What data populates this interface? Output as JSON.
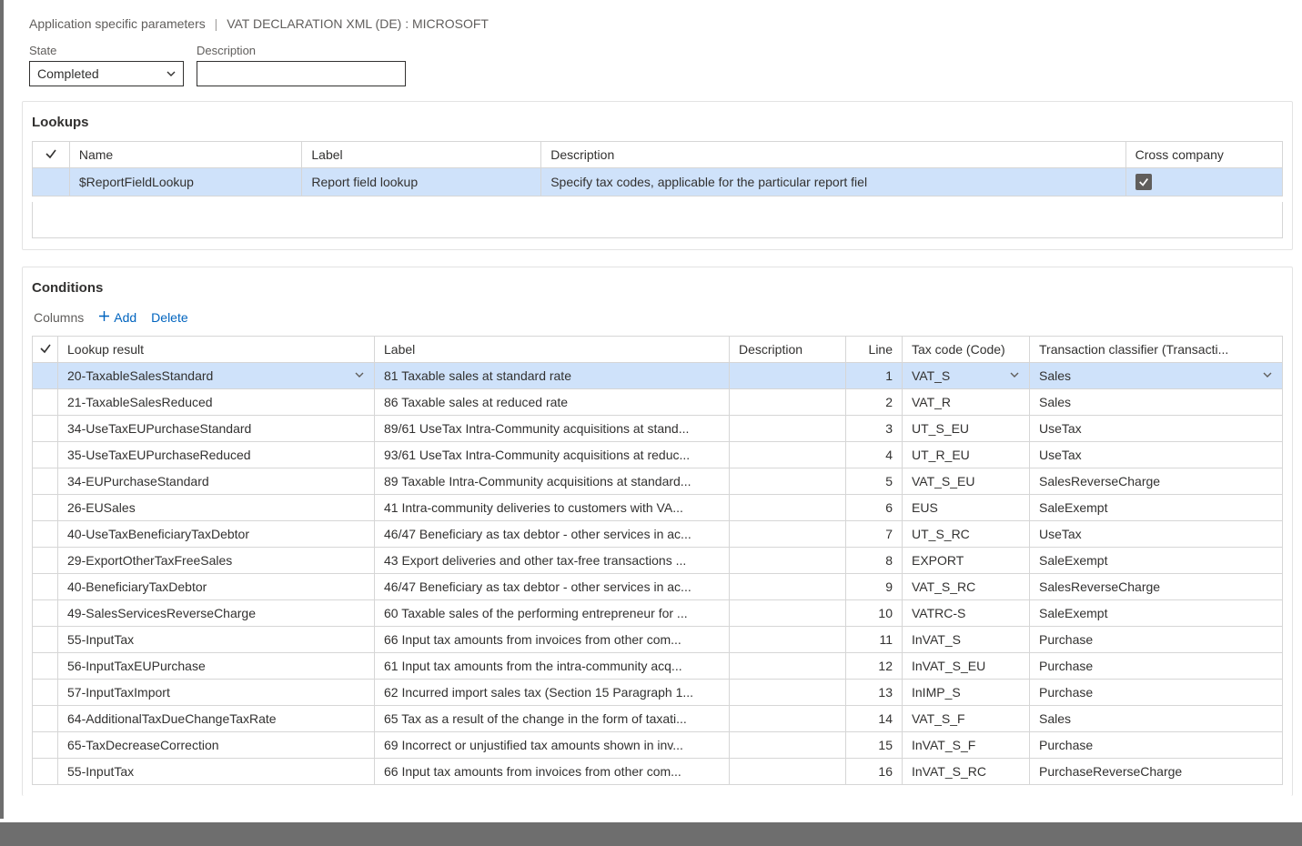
{
  "breadcrumb": {
    "page": "Application specific parameters",
    "context": "VAT DECLARATION XML (DE) : MICROSOFT"
  },
  "fields": {
    "state_label": "State",
    "state_value": "Completed",
    "description_label": "Description",
    "description_value": ""
  },
  "lookups": {
    "title": "Lookups",
    "headers": {
      "name": "Name",
      "label": "Label",
      "description": "Description",
      "cross_company": "Cross company"
    },
    "rows": [
      {
        "name": "$ReportFieldLookup",
        "label": "Report field lookup",
        "description": "Specify tax codes, applicable for the particular report fiel",
        "cross_company": true
      }
    ]
  },
  "conditions": {
    "title": "Conditions",
    "toolbar": {
      "columns": "Columns",
      "add": "Add",
      "delete": "Delete"
    },
    "headers": {
      "lookup_result": "Lookup result",
      "label": "Label",
      "description": "Description",
      "line": "Line",
      "tax_code": "Tax code (Code)",
      "transaction_classifier": "Transaction classifier (Transacti..."
    },
    "rows": [
      {
        "lookup_result": "20-TaxableSalesStandard",
        "label": "81 Taxable sales at standard rate",
        "description": "",
        "line": "1",
        "tax_code": "VAT_S",
        "classifier": "Sales",
        "selected": true
      },
      {
        "lookup_result": "21-TaxableSalesReduced",
        "label": "86 Taxable sales at reduced rate",
        "description": "",
        "line": "2",
        "tax_code": "VAT_R",
        "classifier": "Sales"
      },
      {
        "lookup_result": "34-UseTaxEUPurchaseStandard",
        "label": "89/61 UseTax Intra-Community acquisitions at stand...",
        "description": "",
        "line": "3",
        "tax_code": "UT_S_EU",
        "classifier": "UseTax"
      },
      {
        "lookup_result": "35-UseTaxEUPurchaseReduced",
        "label": "93/61 UseTax Intra-Community acquisitions at reduc...",
        "description": "",
        "line": "4",
        "tax_code": "UT_R_EU",
        "classifier": "UseTax"
      },
      {
        "lookup_result": "34-EUPurchaseStandard",
        "label": "89 Taxable Intra-Community acquisitions at standard...",
        "description": "",
        "line": "5",
        "tax_code": "VAT_S_EU",
        "classifier": "SalesReverseCharge"
      },
      {
        "lookup_result": "26-EUSales",
        "label": "41 Intra-community deliveries to customers with VA...",
        "description": "",
        "line": "6",
        "tax_code": "EUS",
        "classifier": "SaleExempt"
      },
      {
        "lookup_result": "40-UseTaxBeneficiaryTaxDebtor",
        "label": "46/47 Beneficiary as tax debtor - other services in ac...",
        "description": "",
        "line": "7",
        "tax_code": "UT_S_RC",
        "classifier": "UseTax"
      },
      {
        "lookup_result": "29-ExportOtherTaxFreeSales",
        "label": "43 Export deliveries and other tax-free transactions ...",
        "description": "",
        "line": "8",
        "tax_code": "EXPORT",
        "classifier": "SaleExempt"
      },
      {
        "lookup_result": "40-BeneficiaryTaxDebtor",
        "label": "46/47 Beneficiary as tax debtor - other services in ac...",
        "description": "",
        "line": "9",
        "tax_code": "VAT_S_RC",
        "classifier": "SalesReverseCharge"
      },
      {
        "lookup_result": "49-SalesServicesReverseCharge",
        "label": "60 Taxable sales of the performing entrepreneur for ...",
        "description": "",
        "line": "10",
        "tax_code": "VATRC-S",
        "classifier": "SaleExempt"
      },
      {
        "lookup_result": "55-InputTax",
        "label": "66 Input tax amounts from invoices from other com...",
        "description": "",
        "line": "11",
        "tax_code": "InVAT_S",
        "classifier": "Purchase"
      },
      {
        "lookup_result": "56-InputTaxEUPurchase",
        "label": "61 Input tax amounts from the intra-community acq...",
        "description": "",
        "line": "12",
        "tax_code": "InVAT_S_EU",
        "classifier": "Purchase"
      },
      {
        "lookup_result": "57-InputTaxImport",
        "label": "62 Incurred import sales tax (Section 15 Paragraph 1...",
        "description": "",
        "line": "13",
        "tax_code": "InIMP_S",
        "classifier": "Purchase"
      },
      {
        "lookup_result": "64-AdditionalTaxDueChangeTaxRate",
        "label": "65 Tax as a result of the change in the form of taxati...",
        "description": "",
        "line": "14",
        "tax_code": "VAT_S_F",
        "classifier": "Sales"
      },
      {
        "lookup_result": "65-TaxDecreaseCorrection",
        "label": "69 Incorrect or unjustified tax amounts shown in inv...",
        "description": "",
        "line": "15",
        "tax_code": "InVAT_S_F",
        "classifier": "Purchase"
      },
      {
        "lookup_result": "55-InputTax",
        "label": "66 Input tax amounts from invoices from other com...",
        "description": "",
        "line": "16",
        "tax_code": "InVAT_S_RC",
        "classifier": "PurchaseReverseCharge"
      }
    ]
  }
}
